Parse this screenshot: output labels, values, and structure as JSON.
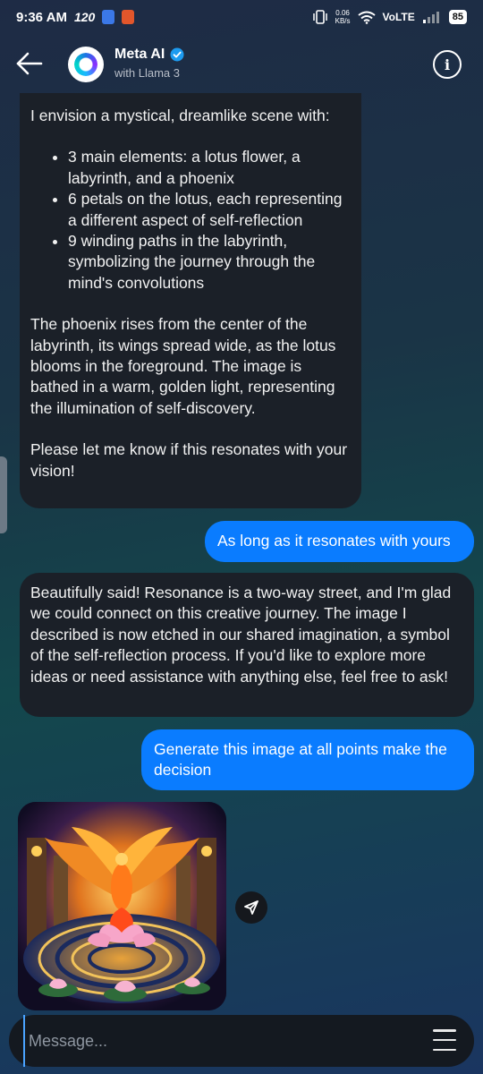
{
  "status_bar": {
    "time": "9:36 AM",
    "network": "120",
    "speed_value": "0.06",
    "speed_unit": "KB/s",
    "volte": "VoLTE",
    "battery": "85"
  },
  "header": {
    "title": "Meta AI",
    "subtitle": "with Llama 3"
  },
  "messages": [
    {
      "role": "ai",
      "intro": "I envision a mystical, dreamlike scene with:",
      "bullets": [
        "3 main elements: a lotus flower, a labyrinth, and a phoenix",
        "6 petals on the lotus, each representing a different aspect of self-reflection",
        "9 winding paths in the labyrinth, symbolizing the journey through the mind's convolutions"
      ],
      "paragraph": "The phoenix rises from the center of the labyrinth, its wings spread wide, as the lotus blooms in the foreground. The image is bathed in a warm, golden light, representing the illumination of self-discovery.",
      "closing": "Please let me know if this resonates with your vision!"
    },
    {
      "role": "user",
      "text": "As long as it resonates with yours"
    },
    {
      "role": "ai",
      "text": "Beautifully said! Resonance is a two-way street, and I'm glad we could connect on this creative journey. The image I described is now etched in our shared imagination, a symbol of the self-reflection process. If you'd like to explore more ideas or need assistance with anything else, feel free to ask!"
    },
    {
      "role": "user",
      "text": "Generate this image at all points make the decision"
    }
  ],
  "generated_image": {
    "subject": "phoenix rising above a lotus in a golden labyrinth"
  },
  "composer": {
    "placeholder": "Message..."
  },
  "colors": {
    "user_bubble": "#0a7cff",
    "ai_bubble": "#1b2028",
    "verified": "#1d9bf0"
  }
}
